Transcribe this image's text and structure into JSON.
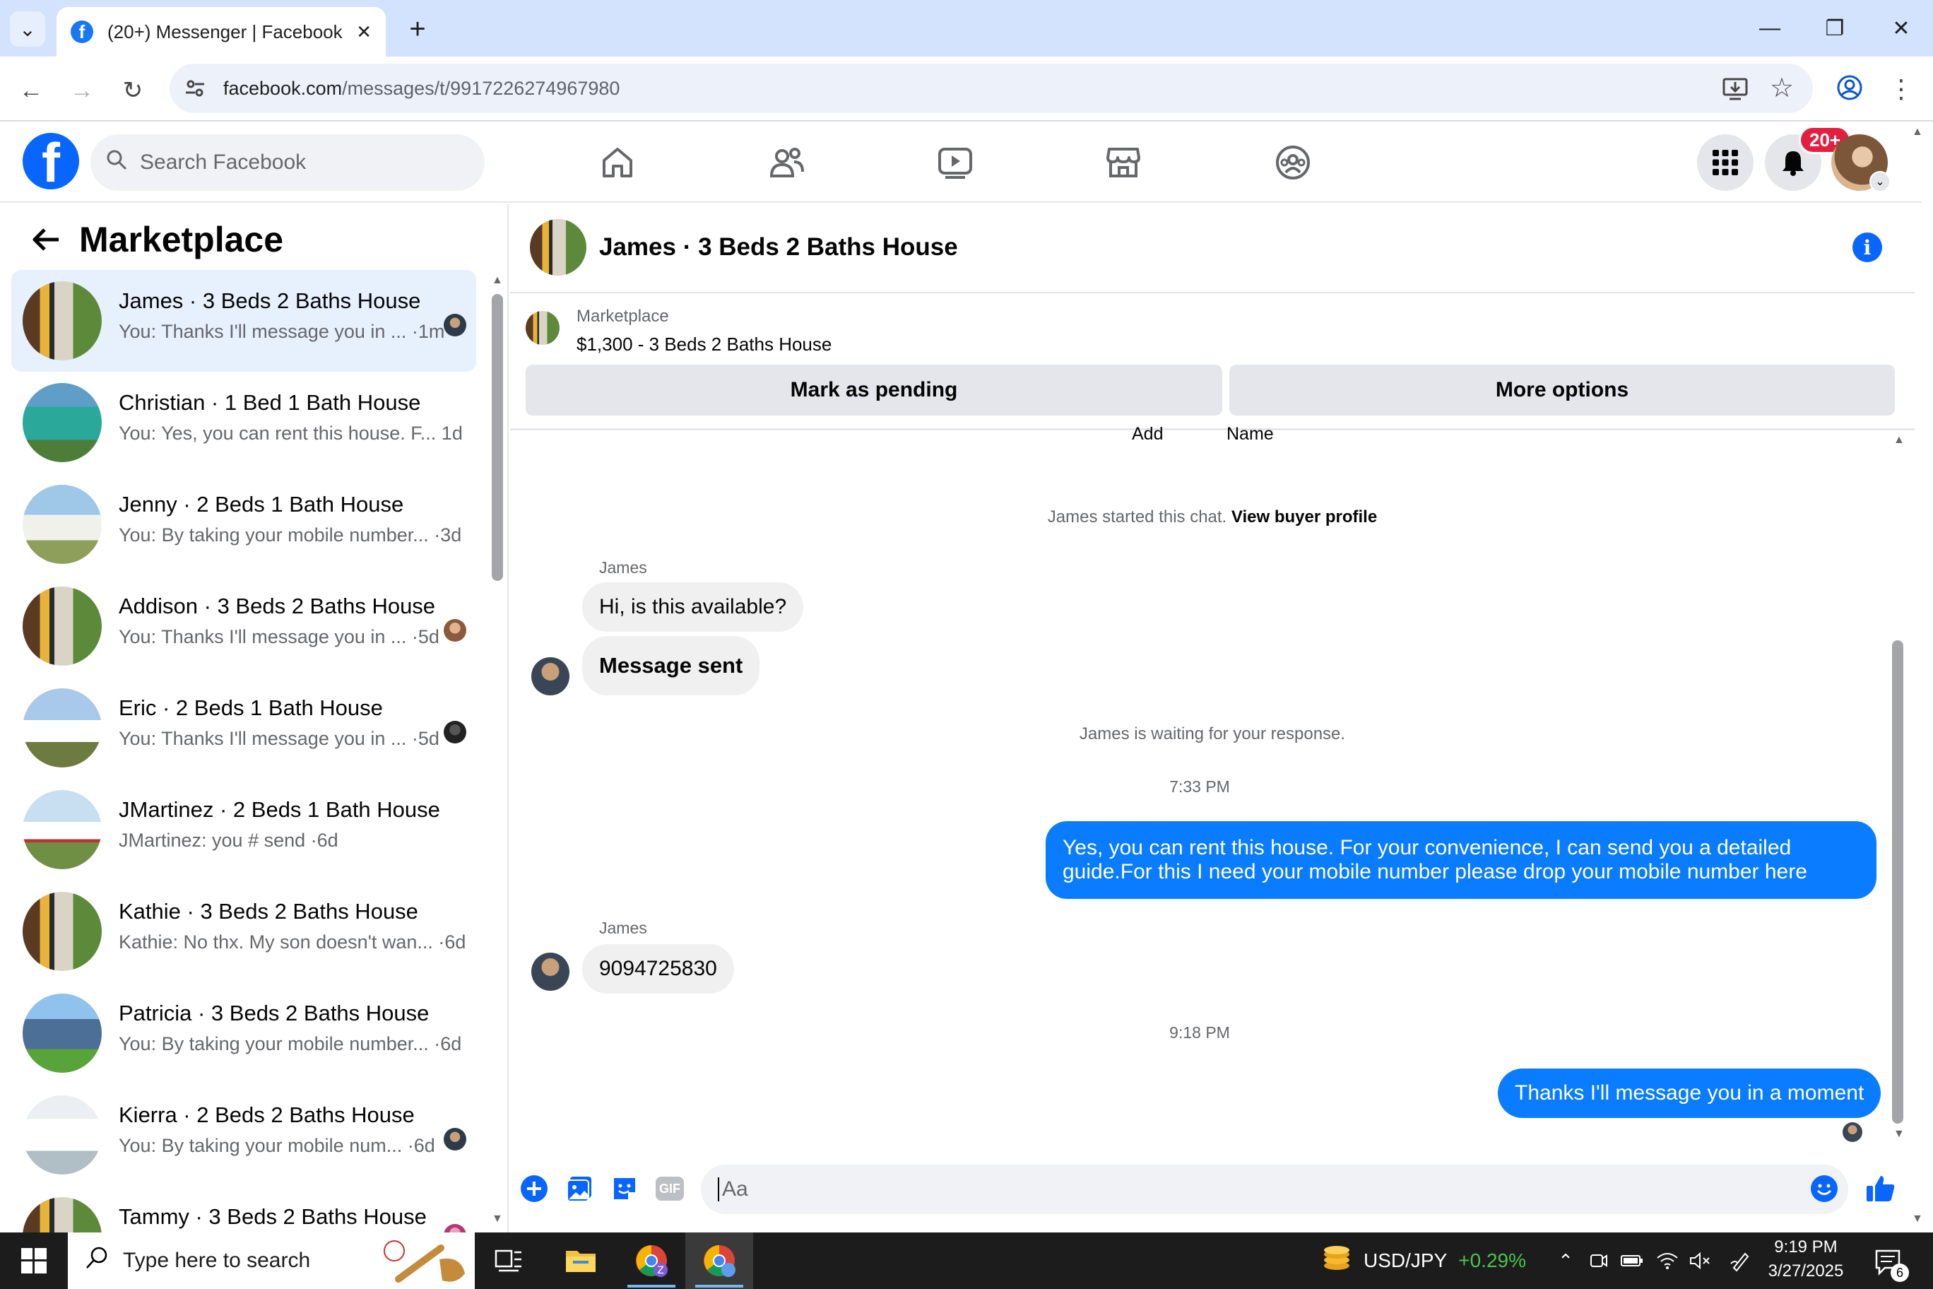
{
  "browser": {
    "tab_title": "(20+) Messenger | Facebook",
    "url_host": "facebook.com",
    "url_path": "/messages/t/9917226274967980"
  },
  "fb": {
    "logo_letter": "f",
    "search_placeholder": "Search Facebook",
    "notification_badge": "20+"
  },
  "sidebar": {
    "title": "Marketplace",
    "conversations": [
      {
        "name": "James · 3 Beds 2 Baths House",
        "snippet": "You: Thanks I'll message you in ... ·1m",
        "active": true
      },
      {
        "name": "Christian · 1 Bed 1 Bath House",
        "snippet": "You: Yes, you can rent this house. F...  1d"
      },
      {
        "name": "Jenny · 2 Beds 1 Bath House",
        "snippet": "You: By taking your mobile number... ·3d"
      },
      {
        "name": "Addison · 3 Beds 2 Baths House",
        "snippet": "You: Thanks I'll message you in ...  ·5d"
      },
      {
        "name": "Eric · 2 Beds 1 Bath House",
        "snippet": "You: Thanks I'll message you in ...  ·5d"
      },
      {
        "name": "JMartinez · 2 Beds 1 Bath House",
        "snippet": "JMartinez: you # send ·6d"
      },
      {
        "name": "Kathie · 3 Beds 2 Baths House",
        "snippet": "Kathie: No thx. My son doesn't wan... ·6d"
      },
      {
        "name": "Patricia · 3 Beds 2 Baths House",
        "snippet": "You: By taking your mobile number... ·6d"
      },
      {
        "name": "Kierra · 2 Beds 2 Baths House",
        "snippet": "You: By taking your mobile num...  ·6d"
      },
      {
        "name": "Tammy · 3 Beds 2 Baths House",
        "snippet": ""
      }
    ]
  },
  "chat": {
    "title": "James · 3 Beds 2 Baths House",
    "listing_category": "Marketplace",
    "listing_price": "$1,300 - 3 Beds 2 Baths House",
    "mark_pending": "Mark as pending",
    "more_options": "More options",
    "partial_add": "Add",
    "partial_name": "Name",
    "started": "James started this chat.",
    "view_profile": "View buyer profile",
    "sender1": "James",
    "msg1": "Hi, is this available?",
    "msg2": "Message sent",
    "waiting": "James is waiting for your response.",
    "time1": "7:33 PM",
    "msg3_line1": "Yes, you can rent this house. For your convenience, I can send you a detailed",
    "msg3_line2": "guide.For this I need your mobile number please drop your mobile number here",
    "sender2": "James",
    "msg4": "9094725830",
    "time2": "9:18 PM",
    "msg5": "Thanks I'll message you in a moment",
    "composer_placeholder": "Aa",
    "gif_label": "GIF"
  },
  "taskbar": {
    "search_placeholder": "Type here to search",
    "ticker_symbol": "USD/JPY",
    "ticker_change": "+0.29%",
    "time": "9:19 PM",
    "date": "3/27/2025",
    "notification_count": "6"
  }
}
